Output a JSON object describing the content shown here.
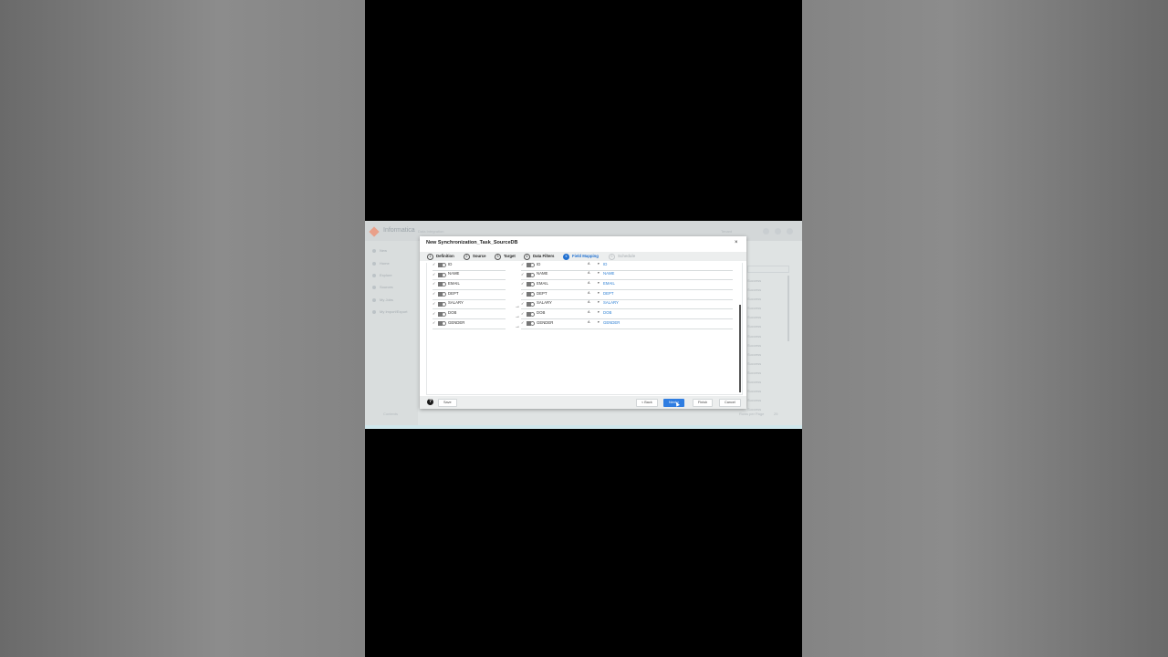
{
  "background_app": {
    "brand": "Informatica",
    "brand_sub": "Data Integration",
    "user": "Tenant",
    "nav": [
      "New",
      "Home",
      "Explore",
      "Sources",
      "My Jobs",
      "My Import/Export"
    ],
    "status_list": [
      "Success",
      "Success",
      "Success",
      "Success",
      "Success",
      "Success",
      "Success",
      "Success",
      "Success",
      "Success",
      "Success",
      "Success",
      "Success",
      "Success",
      "Success"
    ],
    "footer_left": "Contents",
    "footer_rows": "Rows per Page",
    "footer_count": "25"
  },
  "modal": {
    "title": "New Synchronization_Task_SourceDB",
    "close": "×",
    "steps": [
      {
        "num": "1",
        "label": "Definition",
        "state": "done"
      },
      {
        "num": "2",
        "label": "Source",
        "state": "done"
      },
      {
        "num": "3",
        "label": "Target",
        "state": "done"
      },
      {
        "num": "4",
        "label": "Data Filters",
        "state": "done"
      },
      {
        "num": "5",
        "label": "Field Mapping",
        "state": "active"
      },
      {
        "num": "6",
        "label": "Schedule",
        "state": "disabled"
      }
    ],
    "source_fields": [
      "ID",
      "NAME",
      "EMAIL",
      "DEPT",
      "SALARY",
      "DOB",
      "GENDER"
    ],
    "target_fields": [
      {
        "name": "ID",
        "mapped": "ID"
      },
      {
        "name": "NAME",
        "mapped": "NAME"
      },
      {
        "name": "EMAIL",
        "mapped": "EMAIL"
      },
      {
        "name": "DEPT",
        "mapped": "DEPT"
      },
      {
        "name": "SALARY",
        "mapped": "SALARY"
      },
      {
        "name": "DOB",
        "mapped": "DOB"
      },
      {
        "name": "GENDER",
        "mapped": "GENDER"
      }
    ],
    "check": "✓",
    "fx": "A",
    "dropdown": "▾",
    "connector": "→",
    "help": "?",
    "buttons": {
      "save": "Save",
      "back": "< Back",
      "next": "Next >",
      "finish": "Finish",
      "cancel": "Cancel"
    }
  },
  "colors": {
    "accent": "#2f7de1",
    "mapped_link": "#2d7fd3"
  }
}
